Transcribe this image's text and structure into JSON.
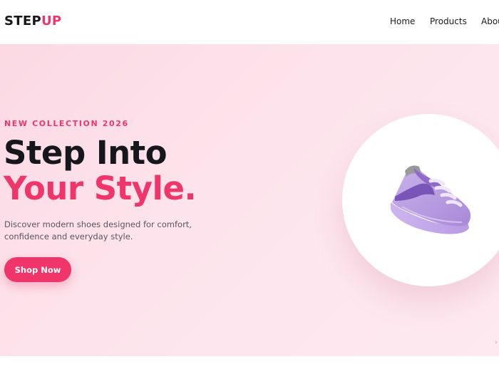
{
  "brand": {
    "logo_part1": "STEP",
    "logo_part2": "UP"
  },
  "nav": {
    "links": [
      {
        "label": "Home"
      },
      {
        "label": "Products"
      },
      {
        "label": "Abou"
      }
    ]
  },
  "hero": {
    "eyebrow": "NEW COLLECTION 2026",
    "headline_line1": "Step Into",
    "headline_line2": "Your Style.",
    "description": "Discover modern shoes designed for comfort, confidence and everyday style.",
    "cta_label": "Shop Now",
    "image_icon": "sneaker-icon"
  },
  "colors": {
    "accent": "#f0356b",
    "dark_text": "#16161d",
    "hero_bg": "#fde4ec"
  }
}
